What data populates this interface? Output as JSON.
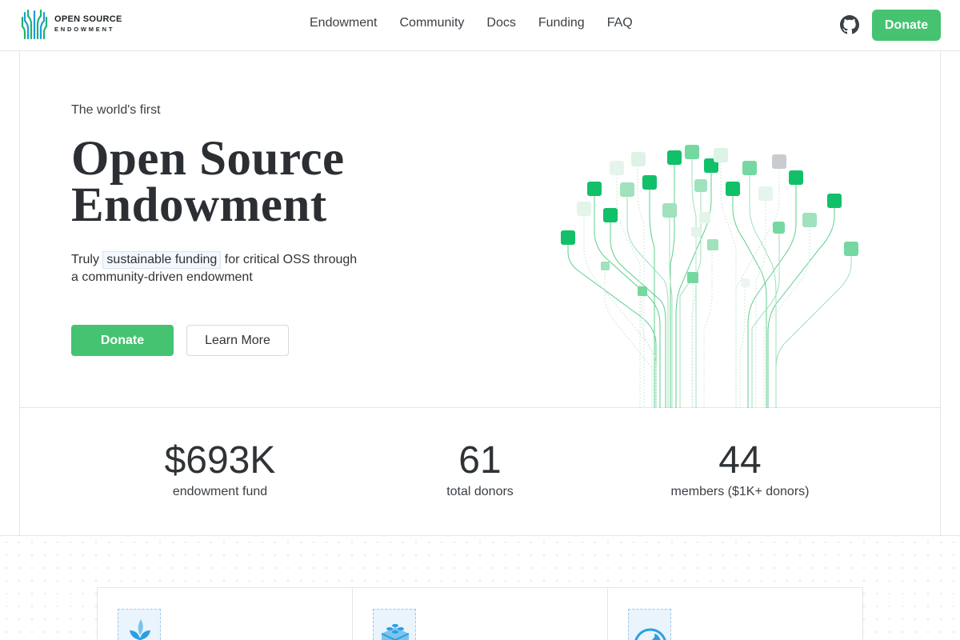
{
  "brand": {
    "line1": "OPEN SOURCE",
    "line2": "ENDOWMENT",
    "accent_color": "#45c371",
    "logo_color": "#1fb36b"
  },
  "nav": {
    "items": [
      {
        "label": "Endowment"
      },
      {
        "label": "Community"
      },
      {
        "label": "Docs"
      },
      {
        "label": "Funding"
      },
      {
        "label": "FAQ"
      }
    ],
    "github_icon": "github-icon",
    "donate_label": "Donate"
  },
  "hero": {
    "eyebrow": "The world's first",
    "title_line1": "Open Source",
    "title_line2": "Endowment",
    "subtitle_pre": "Truly",
    "subtitle_highlight": "sustainable funding",
    "subtitle_post": "for critical OSS through a community-driven endowment",
    "donate_label": "Donate",
    "learn_more_label": "Learn More"
  },
  "stats": [
    {
      "value": "$693K",
      "label": "endowment fund"
    },
    {
      "value": "61",
      "label": "total donors"
    },
    {
      "value": "44",
      "label": "members ($1K+ donors)"
    }
  ],
  "features": [
    {
      "icon": "sprout-icon"
    },
    {
      "icon": "lego-brick-icon"
    },
    {
      "icon": "gauge-icon"
    }
  ]
}
